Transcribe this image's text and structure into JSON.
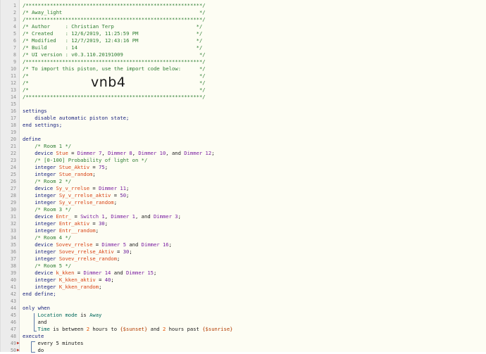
{
  "editor": {
    "line_numbers": [
      "1",
      "2",
      "3",
      "4",
      "5",
      "6",
      "7",
      "8",
      "9",
      "10",
      "11",
      "12",
      "13",
      "14",
      "15",
      "16",
      "17",
      "18",
      "19",
      "20",
      "21",
      "22",
      "23",
      "24",
      "25",
      "26",
      "27",
      "28",
      "29",
      "30",
      "31",
      "32",
      "33",
      "34",
      "35",
      "36",
      "37",
      "38",
      "39",
      "40",
      "41",
      "42",
      "43",
      "44",
      "45",
      "46",
      "47",
      "48",
      "49",
      "50"
    ],
    "header": {
      "border": "/**********************************************************/",
      "title_line": "/* Away_light                                             */",
      "author_line": "/* Author     : Christian Terp                           */",
      "created_line": "/* Created    : 12/6/2019, 11:25:59 PM                   */",
      "modified_line": "/* Modified   : 12/7/2019, 12:43:16 PM                   */",
      "build_line": "/* Build      : 14                                       */",
      "ui_line": "/* UI version : v0.3.110.20191009                         */",
      "import_line": "/* To import this piston, use the import code below:      */",
      "blank_line": "/*                                                        */",
      "import_code": "vnb4"
    },
    "settings": {
      "open": "settings",
      "body": "disable automatic piston state;",
      "close": "end settings;"
    },
    "define": {
      "open": "define",
      "close": "end define;",
      "room1_comment": "/* Room 1 */",
      "stue_kw": "device",
      "stue_var": "Stue",
      "stue_eq": " = ",
      "stue_d1": "Dimmer 7",
      "stue_d2": "Dimmer 8",
      "stue_d3": "Dimmer 10",
      "stue_and": ", and ",
      "stue_d4": "Dimmer 12",
      "prob_comment": "/* [0-100] Probability of light on */",
      "l26_kw": "integer",
      "l26_var": "Stue_Aktiv",
      "l26_val": "75",
      "l27_var": "Stue_random",
      "room2_comment": "/* Room 2 */",
      "sy_var": "Sy_v_rrelse",
      "sy_d1": "Dimmer 11",
      "sy_aktiv_var": "Sy_v_rrelse_aktiv",
      "sy_aktiv_val": "50",
      "sy_random_var": "Sy_v_rrelse_random",
      "room3_comment": "/* Room 3 */",
      "entr_var": "Entr_",
      "entr_d1": "Switch 1",
      "entr_d2": "Dimmer 1",
      "entr_and": ", and ",
      "entr_d3": "Dimmer 3",
      "entr_aktiv_var": "Entr_aktiv",
      "entr_aktiv_val": "30",
      "entr_random_var": "Entr__random",
      "room4_comment": "/* Room 4 */",
      "sov_var": "Sovev_rrelse",
      "sov_d1": "Dimmer 5",
      "sov_and": " and ",
      "sov_d2": "Dimmer 16",
      "sov_aktiv_var": "Sovev_rrelse_Aktiv",
      "sov_aktiv_val": "30",
      "sov_random_var": "Sovev_rrelse_random",
      "room5_comment": "/* Room 5 */",
      "k_var": "k_kken",
      "k_d1": "Dimmer 14",
      "k_and": " and ",
      "k_d2": "Dimmer 15",
      "k_aktiv_var": "K_kken_aktiv",
      "k_aktiv_val": "40",
      "k_random_var": "K_kken_random"
    },
    "only_when": {
      "open": "only when",
      "cond1_attr": "Location mode",
      "cond1_is": " is ",
      "cond1_val": "Away",
      "and": "and",
      "cond2_attr": "Time",
      "cond2_is": " is between ",
      "cond2_n1": "2",
      "cond2_u1": " hours to ",
      "cond2_v1": "{$sunset}",
      "cond2_and": " and ",
      "cond2_n2": "2",
      "cond2_u2": " hours past ",
      "cond2_v2": "{$sunrise}"
    },
    "execute": {
      "open": "execute",
      "every": "every 5 minutes",
      "do": "do"
    },
    "colors": {
      "comment": "#2e7d32",
      "keyword": "#1a237e",
      "variable": "#d84315",
      "device": "#7b1fa2"
    }
  }
}
